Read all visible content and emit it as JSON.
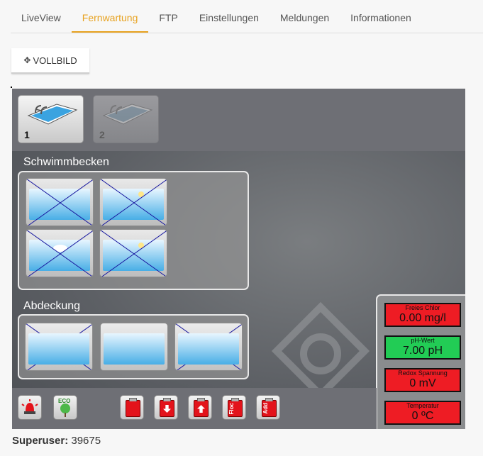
{
  "tabs": [
    {
      "label": "LiveView"
    },
    {
      "label": "Fernwartung"
    },
    {
      "label": "FTP"
    },
    {
      "label": "Einstellungen"
    },
    {
      "label": "Meldungen"
    },
    {
      "label": "Informationen"
    }
  ],
  "active_tab": "Fernwartung",
  "fullscreen_button": {
    "label": "VOLLBILD",
    "icon": "expand-icon"
  },
  "pools": [
    {
      "number": "1",
      "state": "selected"
    },
    {
      "number": "2",
      "state": "disabled"
    }
  ],
  "pool_section": {
    "title": "Schwimmbecken"
  },
  "cover_section": {
    "title": "Abdeckung"
  },
  "measurements": [
    {
      "label": "Freies Chlor",
      "value": "0.00 mg/l",
      "color": "#ee1c24"
    },
    {
      "label": "pH-Wert",
      "value": "7.00 pH",
      "color": "#22cc55"
    },
    {
      "label": "Redox Spannung",
      "value": "0 mV",
      "color": "#ee1c24"
    },
    {
      "label": "Temperatur",
      "value": "0 ºC",
      "color": "#ee1c24"
    }
  ],
  "bottom_buttons": {
    "eco_label": "ECO",
    "dosing_labels": [
      "Floc",
      "Add"
    ]
  },
  "footer": {
    "user_label": "Superuser:",
    "user_id": "39675"
  },
  "colors": {
    "accent": "#e8a321",
    "alarm_red": "#ee1c24",
    "ok_green": "#22cc55"
  }
}
